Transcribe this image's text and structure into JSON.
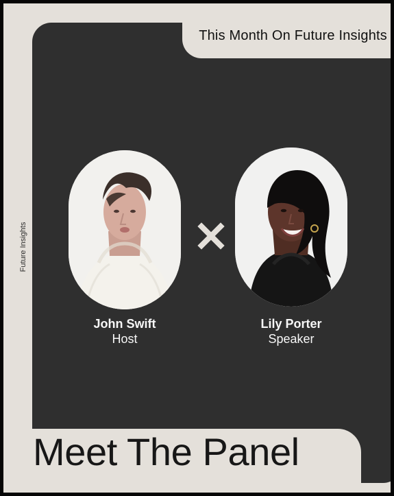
{
  "header": {
    "tag": "This Month On Future Insights"
  },
  "side_label": "Future Insights",
  "panel": [
    {
      "name": "John Swift",
      "role": "Host"
    },
    {
      "name": "Lily Porter",
      "role": "Speaker"
    }
  ],
  "title": "Meet The Panel",
  "colors": {
    "background": "#e4e0da",
    "card": "#2f2f2f",
    "text_dark": "#171717",
    "text_light": "#f7f7f7"
  },
  "icons": {
    "separator": "cross-icon"
  }
}
